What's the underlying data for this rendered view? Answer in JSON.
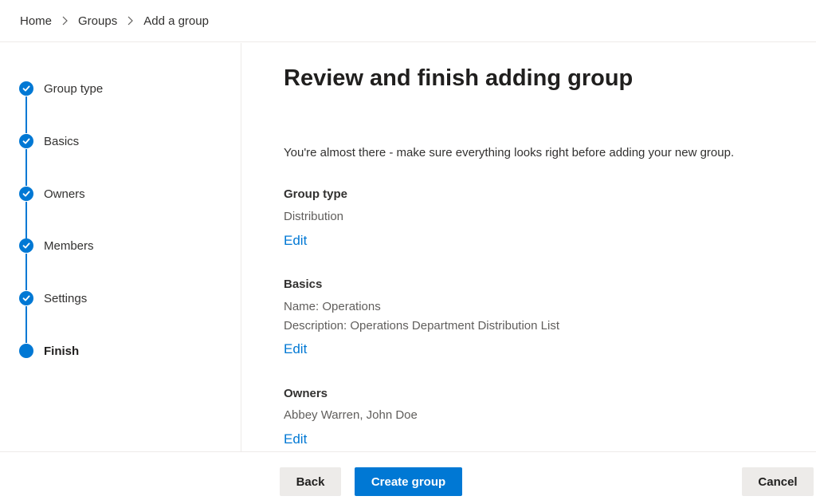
{
  "breadcrumb": {
    "items": [
      "Home",
      "Groups",
      "Add a group"
    ]
  },
  "steps": [
    {
      "label": "Group type",
      "state": "complete"
    },
    {
      "label": "Basics",
      "state": "complete"
    },
    {
      "label": "Owners",
      "state": "complete"
    },
    {
      "label": "Members",
      "state": "complete"
    },
    {
      "label": "Settings",
      "state": "complete"
    },
    {
      "label": "Finish",
      "state": "current"
    }
  ],
  "main": {
    "title": "Review and finish adding group",
    "intro": "You're almost there - make sure everything looks right before adding your new group.",
    "sections": [
      {
        "title": "Group type",
        "values": [
          "Distribution"
        ],
        "edit_label": "Edit"
      },
      {
        "title": "Basics",
        "values": [
          "Name: Operations",
          "Description: Operations Department Distribution List"
        ],
        "edit_label": "Edit"
      },
      {
        "title": "Owners",
        "values": [
          "Abbey Warren, John Doe"
        ],
        "edit_label": "Edit"
      }
    ]
  },
  "footer": {
    "back_label": "Back",
    "create_label": "Create group",
    "cancel_label": "Cancel"
  },
  "colors": {
    "accent": "#0078d4",
    "secondary_button": "#edebe9",
    "text": "#323130"
  },
  "icons": {
    "step_complete": "checkmark-icon",
    "breadcrumb_separator": "chevron-right-icon"
  }
}
